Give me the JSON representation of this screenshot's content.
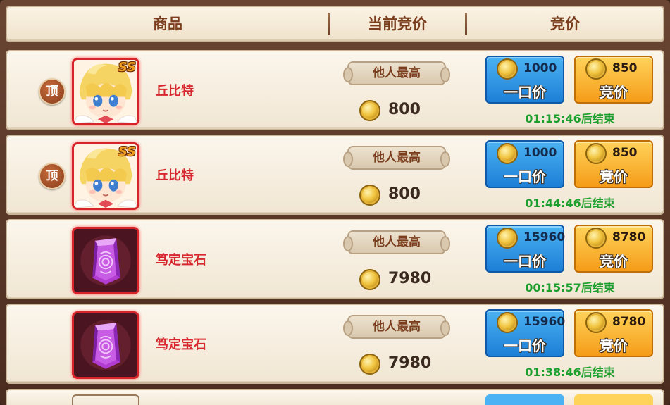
{
  "header": {
    "col_item": "商品",
    "col_current_bid": "当前竞价",
    "col_bid": "竞价"
  },
  "rows": [
    {
      "pinned_badge": "顶",
      "item_type": "character",
      "rank_tag": "SS",
      "name": "丘比特",
      "status": "他人最高",
      "current_bid": "800",
      "buyout_price": "1000",
      "buyout_label": "一口价",
      "bid_price": "850",
      "bid_label": "竞价",
      "timer": "01:15:46后结束"
    },
    {
      "pinned_badge": "顶",
      "item_type": "character",
      "rank_tag": "SS",
      "name": "丘比特",
      "status": "他人最高",
      "current_bid": "800",
      "buyout_price": "1000",
      "buyout_label": "一口价",
      "bid_price": "850",
      "bid_label": "竞价",
      "timer": "01:44:46后结束"
    },
    {
      "pinned_badge": "",
      "item_type": "gem",
      "rank_tag": "",
      "name": "笃定宝石",
      "status": "他人最高",
      "current_bid": "7980",
      "buyout_price": "15960",
      "buyout_label": "一口价",
      "bid_price": "8780",
      "bid_label": "竞价",
      "timer": "00:15:57后结束"
    },
    {
      "pinned_badge": "",
      "item_type": "gem",
      "rank_tag": "",
      "name": "笃定宝石",
      "status": "他人最高",
      "current_bid": "7980",
      "buyout_price": "15960",
      "buyout_label": "一口价",
      "bid_price": "8780",
      "bid_label": "竞价",
      "timer": "01:38:46后结束"
    }
  ],
  "colors": {
    "item_name": "#d7262e",
    "timer": "#1c9f2c",
    "buyout_button": "#1d7fd6",
    "bid_button": "#f59c18",
    "header_text": "#7a3d1e"
  }
}
